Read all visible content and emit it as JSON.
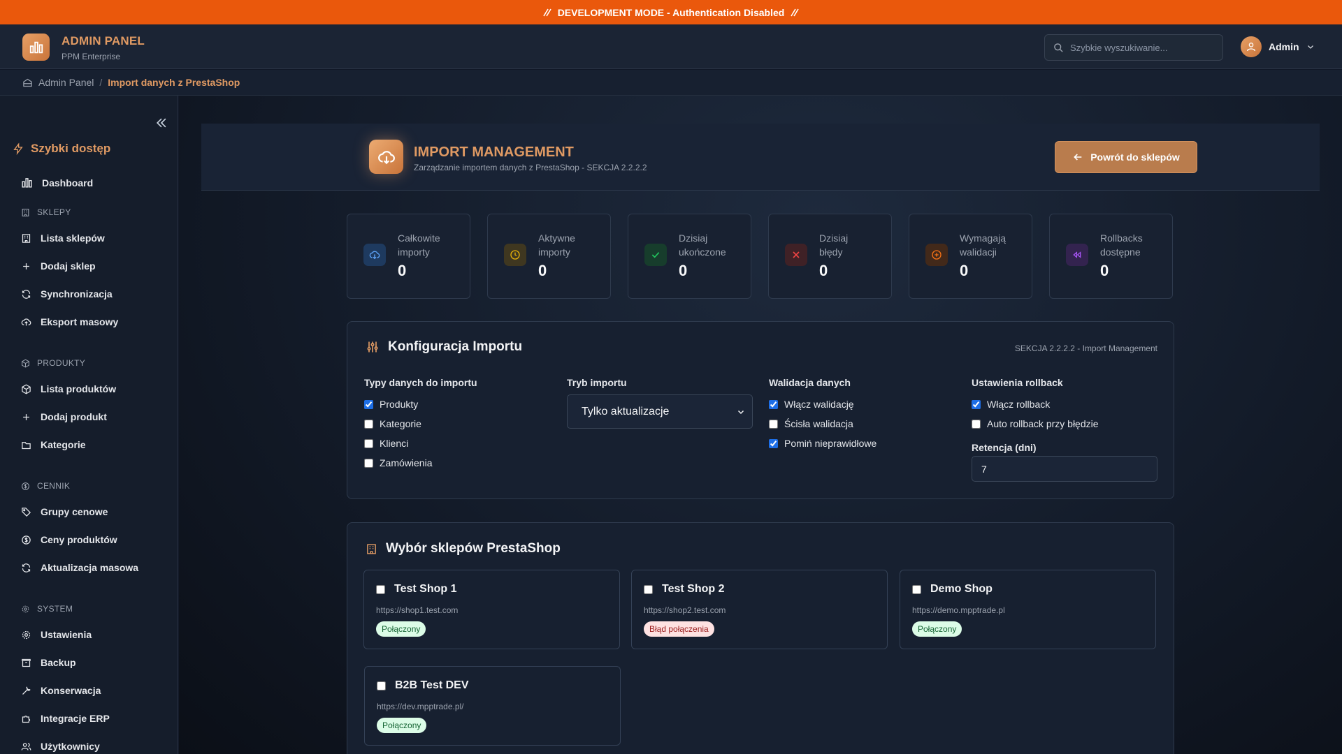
{
  "dev_banner": {
    "text": "DEVELOPMENT MODE - Authentication Disabled"
  },
  "topbar": {
    "brand_title": "ADMIN PANEL",
    "brand_sub": "PPM Enterprise",
    "search_placeholder": "Szybkie wyszukiwanie...",
    "user_name": "Admin"
  },
  "breadcrumb": {
    "root": "Admin Panel",
    "separator": "/",
    "current": "Import danych z PrestaShop"
  },
  "sidebar": {
    "quick_access": "Szybki dostęp",
    "dashboard": "Dashboard",
    "sections": [
      {
        "title": "SKLEPY",
        "items": [
          "Lista sklepów",
          "Dodaj sklep",
          "Synchronizacja",
          "Eksport masowy"
        ]
      },
      {
        "title": "PRODUKTY",
        "items": [
          "Lista produktów",
          "Dodaj produkt",
          "Kategorie"
        ]
      },
      {
        "title": "CENNIK",
        "items": [
          "Grupy cenowe",
          "Ceny produktów",
          "Aktualizacja masowa"
        ]
      },
      {
        "title": "SYSTEM",
        "items": [
          "Ustawienia",
          "Backup",
          "Konserwacja",
          "Integracje ERP",
          "Użytkownicy"
        ]
      }
    ]
  },
  "header": {
    "title": "IMPORT MANAGEMENT",
    "subtitle": "Zarządzanie importem danych z PrestaShop - SEKCJA 2.2.2.2",
    "back_button": "Powrót do sklepów"
  },
  "stats": [
    {
      "line1": "Całkowite",
      "line2": "importy",
      "value": "0",
      "icon": "cloud-download-icon",
      "color": "#3b82f6"
    },
    {
      "line1": "Aktywne",
      "line2": "importy",
      "value": "0",
      "icon": "clock-icon",
      "color": "#eab308"
    },
    {
      "line1": "Dzisiaj",
      "line2": "ukończone",
      "value": "0",
      "icon": "check-icon",
      "color": "#22c55e"
    },
    {
      "line1": "Dzisiaj",
      "line2": "błędy",
      "value": "0",
      "icon": "x-icon",
      "color": "#ef4444"
    },
    {
      "line1": "Wymagają",
      "line2": "walidacji",
      "value": "0",
      "icon": "alert-circle-icon",
      "color": "#f97316"
    },
    {
      "line1": "Rollbacks",
      "line2": "dostępne",
      "value": "0",
      "icon": "rewind-icon",
      "color": "#a855f7"
    }
  ],
  "config": {
    "title": "Konfiguracja Importu",
    "tag": "SEKCJA 2.2.2.2 - Import Management",
    "types_title": "Typy danych do importu",
    "types": [
      {
        "label": "Produkty",
        "checked": true
      },
      {
        "label": "Kategorie",
        "checked": false
      },
      {
        "label": "Klienci",
        "checked": false
      },
      {
        "label": "Zamówienia",
        "checked": false
      }
    ],
    "mode_title": "Tryb importu",
    "mode_value": "Tylko aktualizacje",
    "validation_title": "Walidacja danych",
    "validation": [
      {
        "label": "Włącz walidację",
        "checked": true
      },
      {
        "label": "Ścisła walidacja",
        "checked": false
      },
      {
        "label": "Pomiń nieprawidłowe",
        "checked": true
      }
    ],
    "rollback_title": "Ustawienia rollback",
    "rollback": [
      {
        "label": "Włącz rollback",
        "checked": true
      },
      {
        "label": "Auto rollback przy błędzie",
        "checked": false
      }
    ],
    "retention_label": "Retencja (dni)",
    "retention_value": "7"
  },
  "shops": {
    "title": "Wybór sklepów PrestaShop",
    "items": [
      {
        "name": "Test Shop 1",
        "url": "https://shop1.test.com",
        "status": "Połączony",
        "ok": true
      },
      {
        "name": "Test Shop 2",
        "url": "https://shop2.test.com",
        "status": "Błąd połączenia",
        "ok": false
      },
      {
        "name": "Demo Shop",
        "url": "https://demo.mpptrade.pl",
        "status": "Połączony",
        "ok": true
      },
      {
        "name": "B2B Test DEV",
        "url": "https://dev.mpptrade.pl/",
        "status": "Połączony",
        "ok": true
      }
    ]
  },
  "colors": {
    "accent": "#e09a63",
    "dev_banner": "#ea580c",
    "checkbox": "#1d6ee6"
  }
}
